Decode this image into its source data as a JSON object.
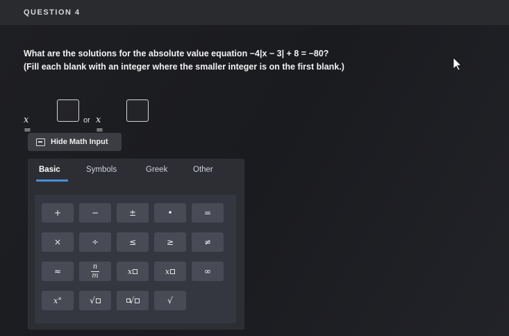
{
  "header": {
    "question_label": "QUESTION 4"
  },
  "question": {
    "prompt": "What are the solutions for the absolute value equation −4|x − 3| + 8 = −80?",
    "instruction": "(Fill each blank with an integer where the smaller integer is on the first blank.)"
  },
  "answers": {
    "first_var": "x =",
    "or_text": "or",
    "second_var": "x =",
    "first_value": "",
    "second_value": ""
  },
  "math_input": {
    "toggle_label": "Hide Math Input",
    "tabs": [
      {
        "label": "Basic",
        "active": true
      },
      {
        "label": "Symbols",
        "active": false
      },
      {
        "label": "Greek",
        "active": false
      },
      {
        "label": "Other",
        "active": false
      }
    ],
    "keys": {
      "plus": "+",
      "minus": "−",
      "plus_minus": "±",
      "dot": "•",
      "equals": "=",
      "times": "×",
      "divide": "÷",
      "leq": "≤",
      "geq": "≥",
      "neq": "≠",
      "approx": "≈",
      "frac_top": "n",
      "frac_bottom": "m",
      "sub_x": "x",
      "sup_x": "x",
      "infinity": "∞",
      "degree": "x°",
      "sqrt": "√",
      "nth_root": "√",
      "radical": "√"
    }
  },
  "colors": {
    "accent": "#4a8fd8",
    "panel": "#2c2e34",
    "key": "#484b55"
  }
}
